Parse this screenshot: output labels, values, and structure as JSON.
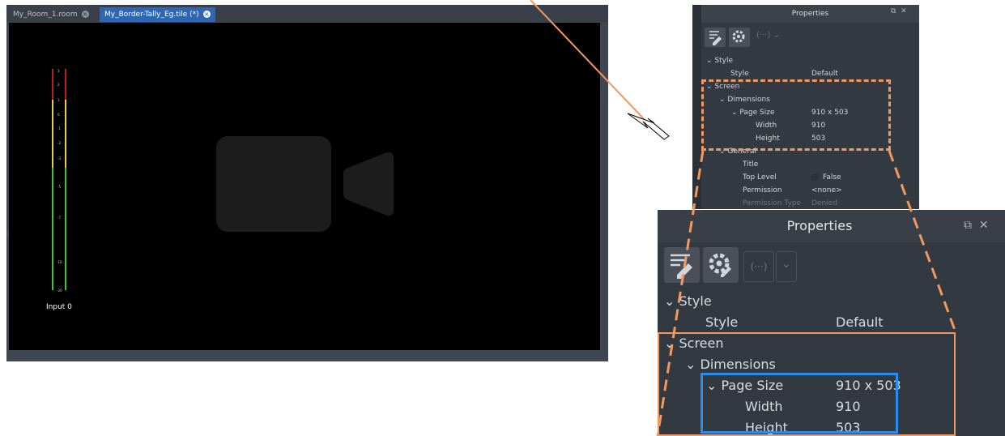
{
  "tabs": [
    {
      "label": "My_Room_1.room",
      "close_icon": "close-icon"
    },
    {
      "label": "My_Border-Tally_Eg.tile (*)",
      "close_icon": "close-icon"
    }
  ],
  "meter": {
    "label": "Input 0",
    "ticks": [
      "3",
      "2",
      "1",
      "0",
      "-1",
      "-2",
      "-3",
      "-5",
      "-7",
      "-10",
      "-20"
    ]
  },
  "properties_small": {
    "title": "Properties",
    "rows": [
      {
        "label": "Style",
        "value": ""
      },
      {
        "label": "Style",
        "value": "Default"
      },
      {
        "label": "Screen",
        "value": ""
      },
      {
        "label": "Dimensions",
        "value": ""
      },
      {
        "label": "Page Size",
        "value": "910 x 503"
      },
      {
        "label": "Width",
        "value": "910"
      },
      {
        "label": "Height",
        "value": "503"
      },
      {
        "label": "General",
        "value": ""
      },
      {
        "label": "Title",
        "value": ""
      },
      {
        "label": "Top Level",
        "value": "False"
      },
      {
        "label": "Permission",
        "value": "<none>"
      },
      {
        "label": "Permission Type",
        "value": "Denied"
      }
    ]
  },
  "properties_zoom": {
    "title": "Properties",
    "rows": [
      {
        "label": "Style",
        "value": ""
      },
      {
        "label": "Style",
        "value": "Default"
      },
      {
        "label": "Screen",
        "value": ""
      },
      {
        "label": "Dimensions",
        "value": ""
      },
      {
        "label": "Page Size",
        "value": "910 x 503"
      },
      {
        "label": "Width",
        "value": "910"
      },
      {
        "label": "Height",
        "value": "503"
      }
    ]
  },
  "colors": {
    "highlight_orange": "#f3985e",
    "highlight_blue": "#2a8cf0",
    "tab_active": "#2f66b3",
    "meter_green": "#3cc83c",
    "meter_yellow": "#e3d23a",
    "meter_red": "#b81e1e"
  }
}
